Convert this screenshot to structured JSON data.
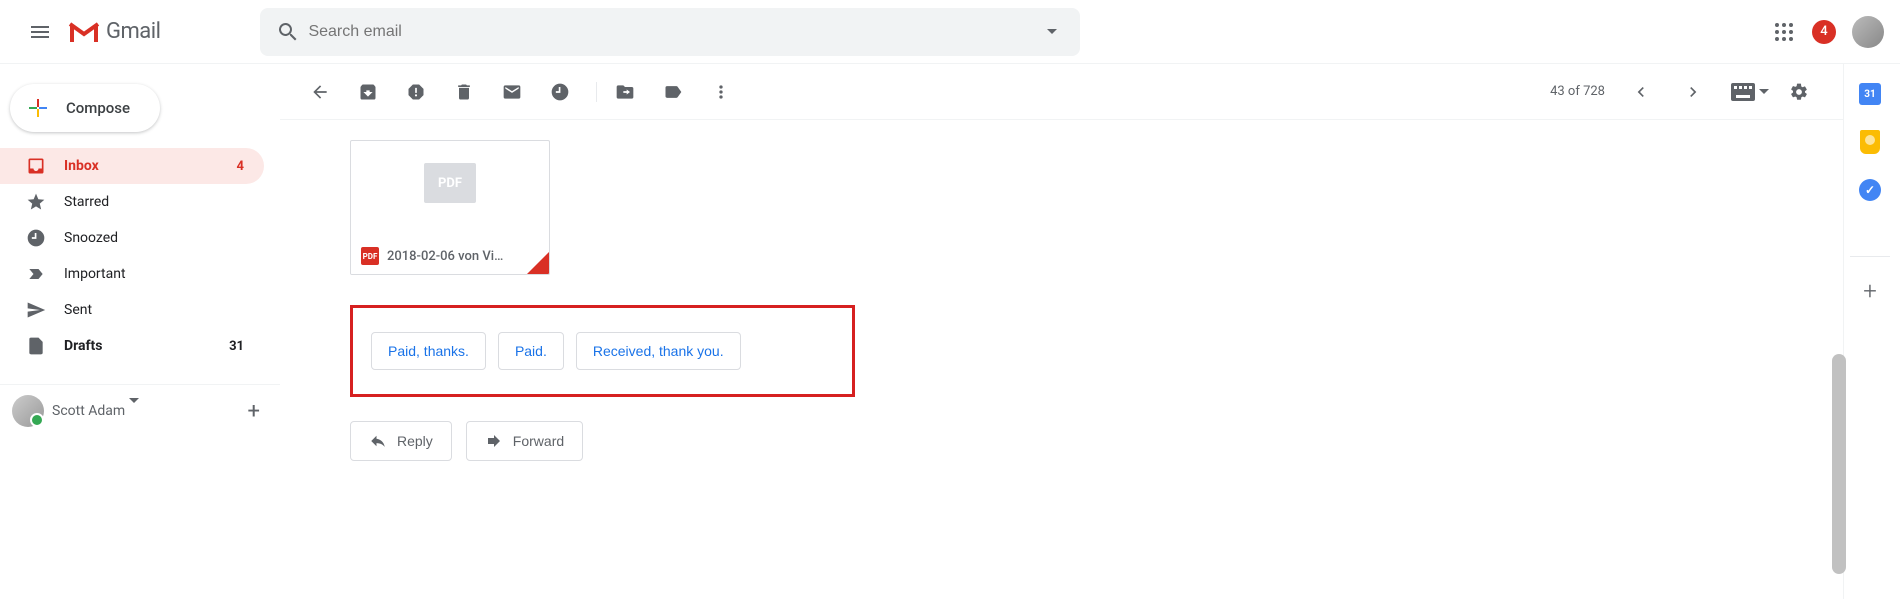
{
  "header": {
    "product_name": "Gmail",
    "search_placeholder": "Search email",
    "notification_count": "4"
  },
  "sidebar": {
    "compose_label": "Compose",
    "items": [
      {
        "label": "Inbox",
        "count": "4",
        "active": true,
        "bold": true
      },
      {
        "label": "Starred",
        "count": "",
        "active": false,
        "bold": false
      },
      {
        "label": "Snoozed",
        "count": "",
        "active": false,
        "bold": false
      },
      {
        "label": "Important",
        "count": "",
        "active": false,
        "bold": false
      },
      {
        "label": "Sent",
        "count": "",
        "active": false,
        "bold": false
      },
      {
        "label": "Drafts",
        "count": "31",
        "active": false,
        "bold": true
      }
    ],
    "hangouts_user": "Scott Adam"
  },
  "toolbar": {
    "pager_text": "43 of 728"
  },
  "attachment": {
    "badge": "PDF",
    "filetype": "PDF",
    "filename": "2018-02-06 von Vi…"
  },
  "smart_replies": [
    "Paid, thanks.",
    "Paid.",
    "Received, thank you."
  ],
  "actions": {
    "reply": "Reply",
    "forward": "Forward"
  },
  "sidepanel": {
    "calendar_day": "31"
  }
}
